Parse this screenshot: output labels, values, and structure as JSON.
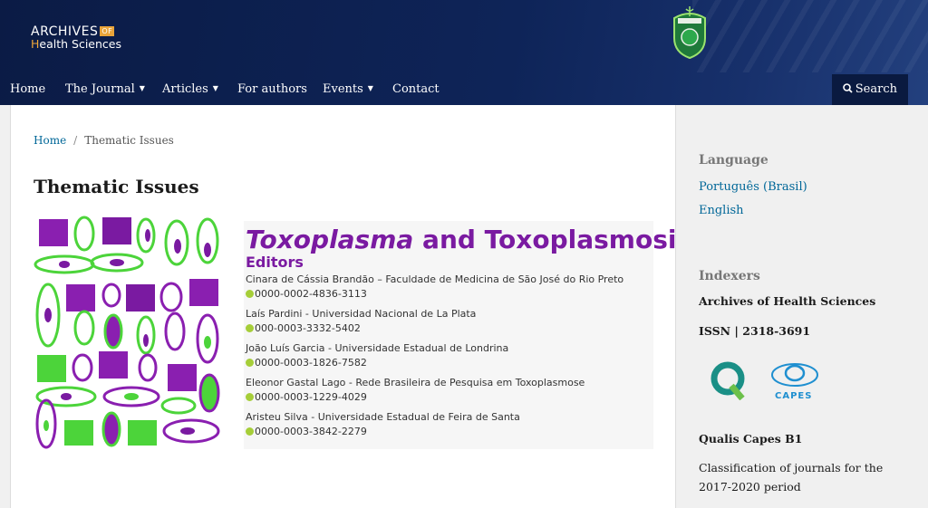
{
  "header": {
    "logo_line1": "ARCHIVES",
    "logo_of": "OF",
    "logo_h": "H",
    "logo_line2_rest": "ealth Sciences",
    "crest_icon": "famerp-crest-icon"
  },
  "nav": {
    "items": [
      {
        "label": "Home"
      },
      {
        "label": "The Journal",
        "dropdown": true
      },
      {
        "label": "Articles",
        "dropdown": true
      },
      {
        "label": "For authors"
      },
      {
        "label": "Events",
        "dropdown": true
      },
      {
        "label": "Contact"
      }
    ],
    "search_label": "Search"
  },
  "breadcrumb": {
    "home": "Home",
    "separator": "/",
    "current": "Thematic Issues"
  },
  "page_title": "Thematic Issues",
  "banner": {
    "title_italic": "Toxoplasma",
    "title_rest": " and Toxoplasmosis",
    "editors_label": "Editors",
    "editors": [
      {
        "name": "Cinara de Cássia Brandão – Faculdade de Medicina de São José do Rio Preto",
        "orcid": "0000-0002-4836-3113"
      },
      {
        "name": "Laís Pardini - Universidad Nacional de La Plata",
        "orcid": "000-0003-3332-5402"
      },
      {
        "name": "João Luís Garcia - Universidade Estadual de Londrina",
        "orcid": "0000-0003-1826-7582"
      },
      {
        "name": "Eleonor Gastal Lago - Rede Brasileira de Pesquisa em Toxoplasmose",
        "orcid": "0000-0003-1229-4029"
      },
      {
        "name": "Aristeu Silva - Universidade Estadual de Feira de Santa",
        "orcid": "0000-0003-3842-2279"
      }
    ],
    "colors": {
      "purple": "#7a1aa1",
      "green": "#4cd43a"
    }
  },
  "sidebar": {
    "language_title": "Language",
    "languages": [
      "Português (Brasil)",
      "English"
    ],
    "indexers_title": "Indexers",
    "journal_name": "Archives of Health Sciences",
    "issn": "ISSN | 2318-3691",
    "capes_label": "CAPES",
    "qualis": "Qualis Capes B1",
    "classification": "Classification of journals for the 2017-2020 period"
  },
  "colors": {
    "header_bg": "#0e2458",
    "link": "#006798"
  }
}
